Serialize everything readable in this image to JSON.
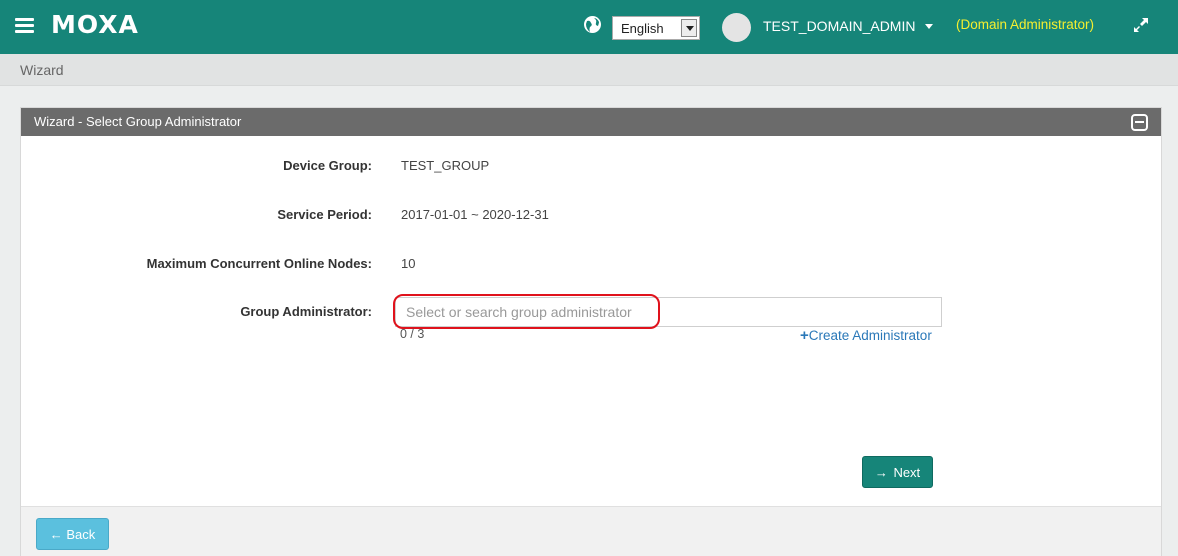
{
  "header": {
    "logo": "MOXA",
    "language": "English",
    "user_name": "TEST_DOMAIN_ADMIN",
    "role": "(Domain Administrator)"
  },
  "breadcrumb": "Wizard",
  "panel": {
    "title": "Wizard - Select Group Administrator",
    "fields": {
      "device_group_label": "Device Group:",
      "device_group_value": "TEST_GROUP",
      "service_period_label": "Service Period:",
      "service_period_value": "2017-01-01 ~ 2020-12-31",
      "max_nodes_label": "Maximum Concurrent Online Nodes:",
      "max_nodes_value": "10",
      "group_admin_label": "Group Administrator:"
    },
    "group_admin_input": {
      "value": "",
      "placeholder": "Select or search group administrator"
    },
    "selection_count": "0 / 3",
    "create_link": "Create Administrator",
    "next_label": "Next",
    "back_label": "Back"
  },
  "colors": {
    "brand": "#168579",
    "role_text": "#f5ef2f",
    "panel_header": "#6b6b6b",
    "highlight": "#e0121c",
    "back_button": "#5bc0de",
    "link": "#2a78b8"
  },
  "icons": [
    "menu-icon",
    "globe-icon",
    "dropdown-arrow-icon",
    "user-avatar-icon",
    "caret-down-icon",
    "expand-icon",
    "collapse-icon",
    "plus-icon",
    "arrow-right-icon",
    "arrow-left-icon"
  ]
}
